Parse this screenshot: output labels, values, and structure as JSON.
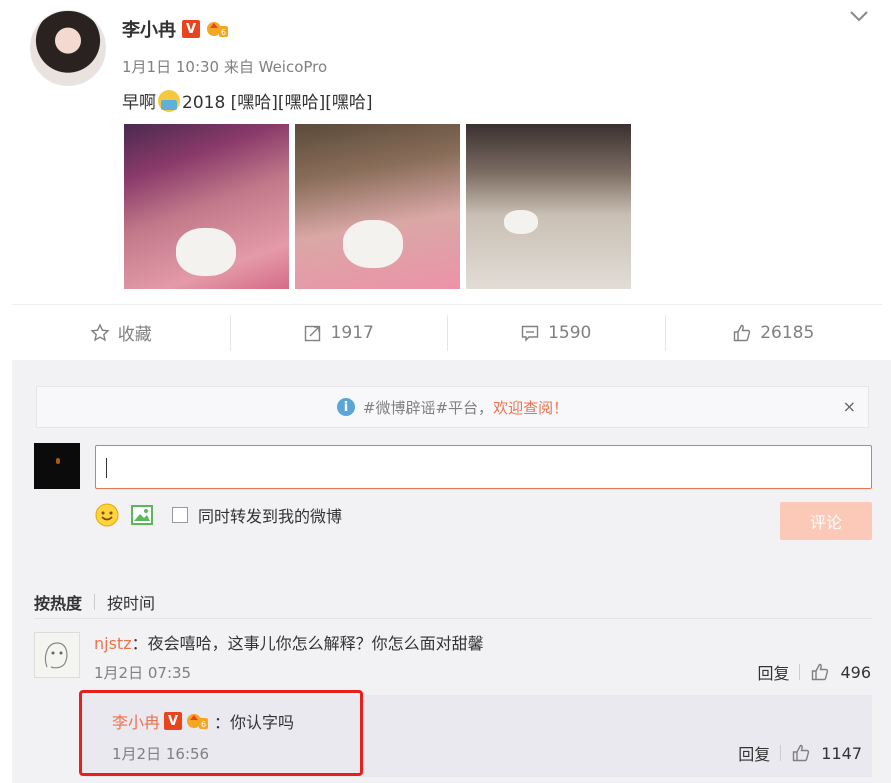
{
  "post": {
    "author": "李小冉",
    "v_badge": "V",
    "meta": "1月1日 10:30 来自 WeicoPro",
    "text_before": "早啊",
    "text_after": "2018 [嘿哈][嘿哈][嘿哈]",
    "photos": [
      "photo-1",
      "photo-2",
      "photo-3"
    ]
  },
  "actions": {
    "favorite": "收藏",
    "repost": "1917",
    "comment": "1590",
    "like": "26185"
  },
  "comment_area": {
    "notice_prefix": "#微博辟谣#平台，",
    "notice_link": "欢迎查阅！",
    "close": "×",
    "input_value": "",
    "checkbox_label": "同时转发到我的微博",
    "submit": "评论",
    "sort_hot": "按热度",
    "sort_time": "按时间"
  },
  "comments": [
    {
      "user": "njstz",
      "text": "：夜会嘻哈，这事儿你怎么解释？你怎么面对甜馨",
      "time": "1月2日 07:35",
      "reply_label": "回复",
      "likes": "496"
    }
  ],
  "reply": {
    "user": "李小冉",
    "v_badge": "V",
    "text": "：你认字吗",
    "time": "1月2日 16:56",
    "reply_label": "回复",
    "likes": "1147"
  },
  "colors": {
    "accent": "#eb7350",
    "verified": "#e8451e",
    "highlight": "#e8201c",
    "muted": "#808080"
  }
}
